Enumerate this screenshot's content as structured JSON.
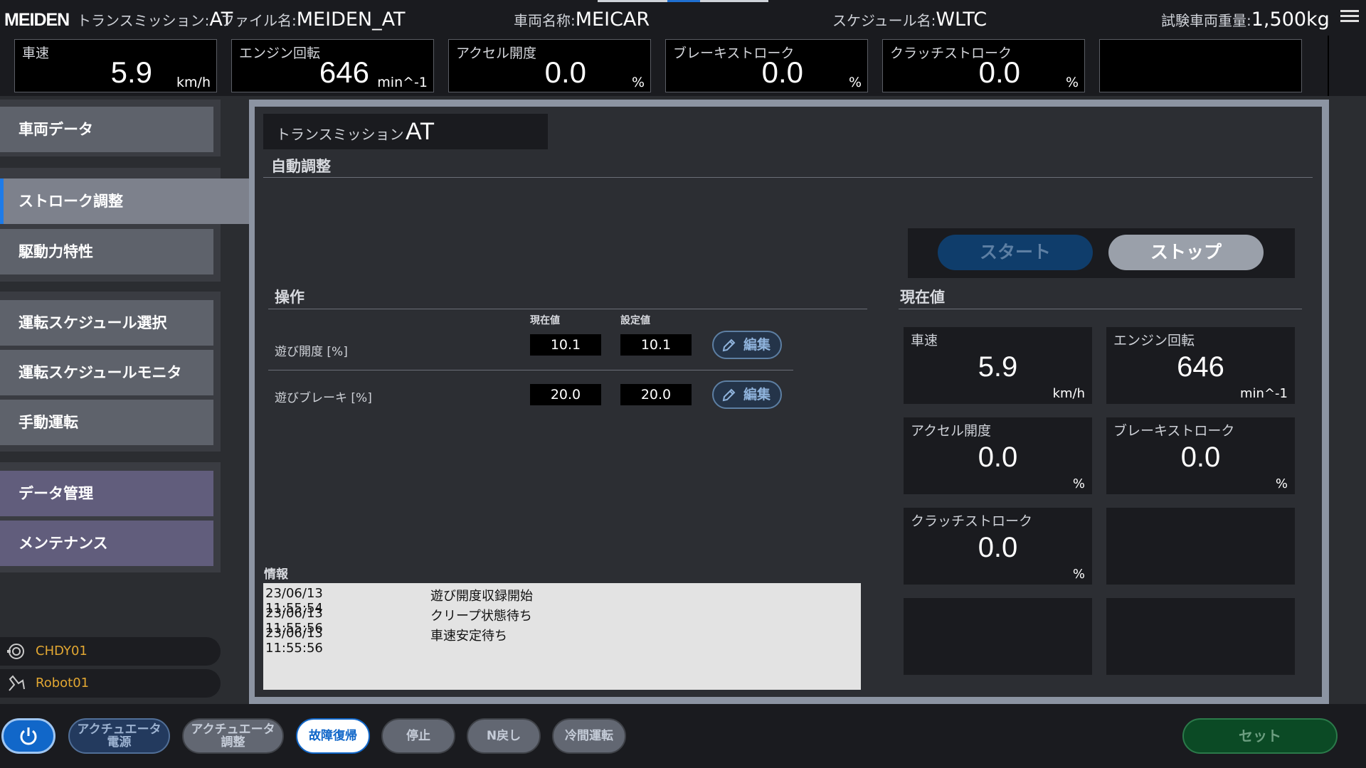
{
  "header": {
    "logo": "MEIDEN",
    "transmission_label": "トランスミッション:",
    "transmission_value": "AT",
    "file_label": "ファイル名:",
    "file_value": "MEIDEN_AT",
    "vehicle_label": "車両名称:",
    "vehicle_value": "MEICAR",
    "schedule_label": "スケジュール名:",
    "schedule_value": "WLTC",
    "weight_label": "試験車両重量:",
    "weight_value": "1,500kg",
    "menu_icon": "hamburger-menu-icon"
  },
  "gauges": [
    {
      "label": "車速",
      "value": "5.9",
      "unit": "km/h"
    },
    {
      "label": "エンジン回転",
      "value": "646",
      "unit": "min^-1"
    },
    {
      "label": "アクセル開度",
      "value": "0.0",
      "unit": "%"
    },
    {
      "label": "ブレーキストローク",
      "value": "0.0",
      "unit": "%"
    },
    {
      "label": "クラッチストローク",
      "value": "0.0",
      "unit": "%"
    },
    {
      "label": "",
      "value": "",
      "unit": ""
    }
  ],
  "sidebar": {
    "items": [
      {
        "label": "車両データ"
      },
      {
        "label": "ストローク調整"
      },
      {
        "label": "駆動力特性"
      },
      {
        "label": "運転スケジュール選択"
      },
      {
        "label": "運転スケジュールモニタ"
      },
      {
        "label": "手動運転"
      },
      {
        "label": "データ管理"
      },
      {
        "label": "メンテナンス"
      }
    ],
    "devices": [
      {
        "label": "CHDY01",
        "icon": "dynamometer-icon"
      },
      {
        "label": "Robot01",
        "icon": "robot-arm-icon"
      }
    ]
  },
  "main": {
    "transmission_label": "トランスミッション",
    "transmission_value": "AT",
    "auto_title": "自動調整",
    "start_label": "スタート",
    "stop_label": "ストップ",
    "operation_title": "操作",
    "current_col": "現在値",
    "set_col": "設定値",
    "rows": [
      {
        "label": "遊び開度 [%]",
        "current": "10.1",
        "set": "10.1",
        "edit": "編集"
      },
      {
        "label": "遊びブレーキ [%]",
        "current": "20.0",
        "set": "20.0",
        "edit": "編集"
      }
    ],
    "current_title": "現在値",
    "tiles": [
      {
        "label": "車速",
        "value": "5.9",
        "unit": "km/h"
      },
      {
        "label": "エンジン回転",
        "value": "646",
        "unit": "min^-1"
      },
      {
        "label": "アクセル開度",
        "value": "0.0",
        "unit": "%"
      },
      {
        "label": "ブレーキストローク",
        "value": "0.0",
        "unit": "%"
      },
      {
        "label": "クラッチストローク",
        "value": "0.0",
        "unit": "%"
      },
      {
        "label": "",
        "value": "",
        "unit": ""
      },
      {
        "label": "",
        "value": "",
        "unit": ""
      },
      {
        "label": "",
        "value": "",
        "unit": ""
      }
    ],
    "info_title": "情報",
    "log": [
      {
        "ts": "23/06/13 11:55:54",
        "msg": "遊び開度収録開始"
      },
      {
        "ts": "23/06/13 11:55:56",
        "msg": "クリープ状態待ち"
      },
      {
        "ts": "23/06/13 11:55:56",
        "msg": "車速安定待ち"
      }
    ]
  },
  "bottom": {
    "power_icon": "power-icon",
    "actuator_power": "アクチュエータ\n電源",
    "actuator_adjust": "アクチュエータ\n調整",
    "fault_reset": "故障復帰",
    "stop": "停止",
    "n_return": "N戻し",
    "cold_run": "冷間運転",
    "set": "セット"
  }
}
